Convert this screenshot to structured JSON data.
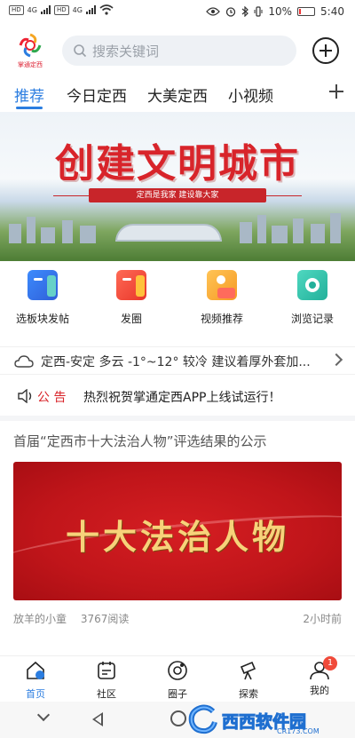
{
  "status_bar": {
    "hd1": "HD",
    "hd2": "HD",
    "net1": "4G",
    "net2": "4G",
    "battery": "10%",
    "time": "5:40",
    "battery_color": "#e33333"
  },
  "top_bar": {
    "logo_text": "掌通定西",
    "search_placeholder": "搜索关键词"
  },
  "tabs": [
    {
      "label": "推荐",
      "active": true
    },
    {
      "label": "今日定西",
      "active": false
    },
    {
      "label": "大美定西",
      "active": false
    },
    {
      "label": "小视频",
      "active": false
    }
  ],
  "banner": {
    "title": "创建文明城市",
    "subtitle": "定西是我家 建设靠大家"
  },
  "quick_grid": [
    {
      "label": "选板块发帖",
      "icon": "post-board-icon",
      "color": "#2f6fe8"
    },
    {
      "label": "发圈",
      "icon": "moments-icon",
      "color": "#f04a3a"
    },
    {
      "label": "视频推荐",
      "icon": "video-recommend-icon",
      "color": "#f5a623"
    },
    {
      "label": "浏览记录",
      "icon": "history-icon",
      "color": "#2fc2a8"
    }
  ],
  "weather": {
    "text": "定西-安定 多云 -1°~12° 较冷 建议着厚外套加..."
  },
  "notice": {
    "tag": "公 告",
    "text": "热烈祝贺掌通定西APP上线试运行！"
  },
  "article": {
    "title": "首届“定西市十大法治人物”评选结果的公示",
    "image_text": "十大法治人物",
    "author": "放羊的小童",
    "reads": "3767阅读",
    "time": "2小时前"
  },
  "bottom_nav": [
    {
      "label": "首页",
      "icon": "home-icon",
      "active": true
    },
    {
      "label": "社区",
      "icon": "community-icon",
      "active": false
    },
    {
      "label": "圈子",
      "icon": "circle-icon",
      "active": false
    },
    {
      "label": "探索",
      "icon": "explore-icon",
      "active": false
    },
    {
      "label": "我的",
      "icon": "profile-icon",
      "active": false,
      "badge": "1"
    }
  ],
  "watermark": {
    "text": "西西软件园",
    "sub": "CR173.COM"
  },
  "colors": {
    "accent": "#2b7de0",
    "notice_red": "#d8242a"
  }
}
